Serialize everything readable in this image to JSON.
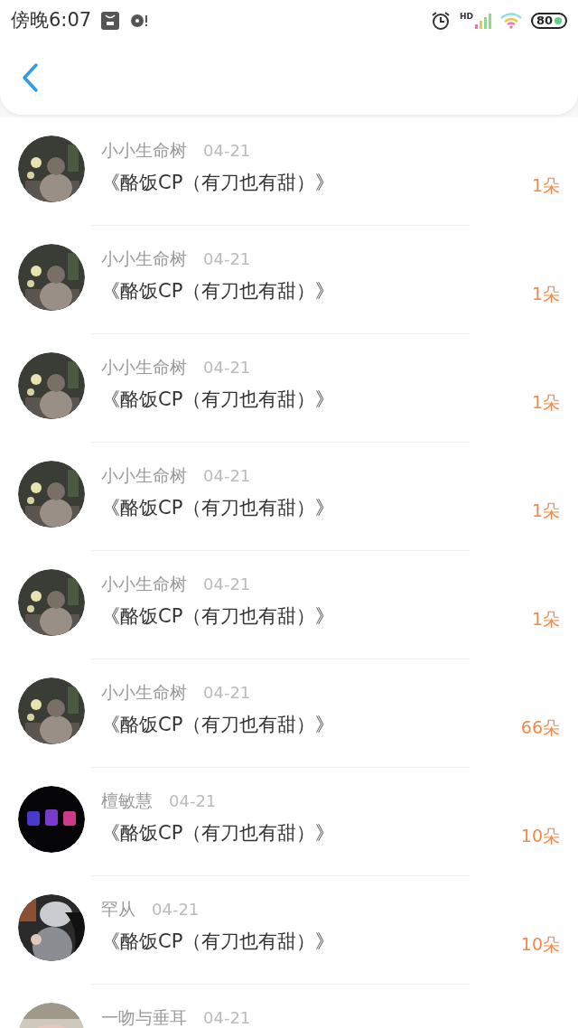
{
  "status_bar": {
    "time": "傍晚6:07",
    "network_label": "HD",
    "battery": "80"
  },
  "rows": [
    {
      "name": "小小生命树",
      "date": "04-21",
      "title": "《酪饭CP（有刀也有甜）》",
      "count": "1朵"
    },
    {
      "name": "小小生命树",
      "date": "04-21",
      "title": "《酪饭CP（有刀也有甜）》",
      "count": "1朵"
    },
    {
      "name": "小小生命树",
      "date": "04-21",
      "title": "《酪饭CP（有刀也有甜）》",
      "count": "1朵"
    },
    {
      "name": "小小生命树",
      "date": "04-21",
      "title": "《酪饭CP（有刀也有甜）》",
      "count": "1朵"
    },
    {
      "name": "小小生命树",
      "date": "04-21",
      "title": "《酪饭CP（有刀也有甜）》",
      "count": "1朵"
    },
    {
      "name": "小小生命树",
      "date": "04-21",
      "title": "《酪饭CP（有刀也有甜）》",
      "count": "66朵"
    },
    {
      "name": "檀敏慧",
      "date": "04-21",
      "title": "《酪饭CP（有刀也有甜）》",
      "count": "10朵"
    },
    {
      "name": "罕从",
      "date": "04-21",
      "title": "《酪饭CP（有刀也有甜）》",
      "count": "10朵"
    },
    {
      "name": "一吻与垂耳",
      "date": "04-21"
    }
  ]
}
